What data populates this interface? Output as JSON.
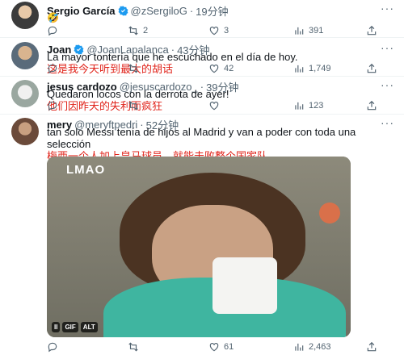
{
  "tweets": [
    {
      "name": "Sergio García",
      "handle": "@zSergiloG",
      "sep": "·",
      "time": "19分钟",
      "emoji": "🤣",
      "actions": {
        "replies": "",
        "retweets": "2",
        "likes": "3",
        "views": "391"
      }
    },
    {
      "name": "Joan",
      "handle": "@JoanLapalanca",
      "sep": "·",
      "time": "43分钟",
      "text": "La mayor tontería que he escuchado en el día de hoy.",
      "translation": "这是我今天听到最大的胡话",
      "actions": {
        "replies": "",
        "retweets": "",
        "likes": "42",
        "views": "1,749"
      }
    },
    {
      "name": "jesus cardozo",
      "handle": "@jesuscardozo_",
      "sep": "·",
      "time": "39分钟",
      "text": "Quedaron locos con la derrota de ayer!",
      "translation": "他们因昨天的失利而疯狂",
      "actions": {
        "replies": "",
        "retweets": "",
        "likes": "",
        "views": "123"
      }
    },
    {
      "name": "mery",
      "handle": "@meryftpedri",
      "sep": "·",
      "time": "52分钟",
      "text": "tan solo Messi tenía de hijos al Madrid y van a poder con toda una selección",
      "translation": "梅西一个人加上皇马球员，就能击败整个国家队",
      "media": {
        "overlay_text": "LMAO",
        "pause": "II",
        "gif": "GIF",
        "alt": "ALT"
      },
      "actions": {
        "replies": "",
        "retweets": "",
        "likes": "61",
        "views": "2,463"
      }
    }
  ],
  "more_label": "···"
}
